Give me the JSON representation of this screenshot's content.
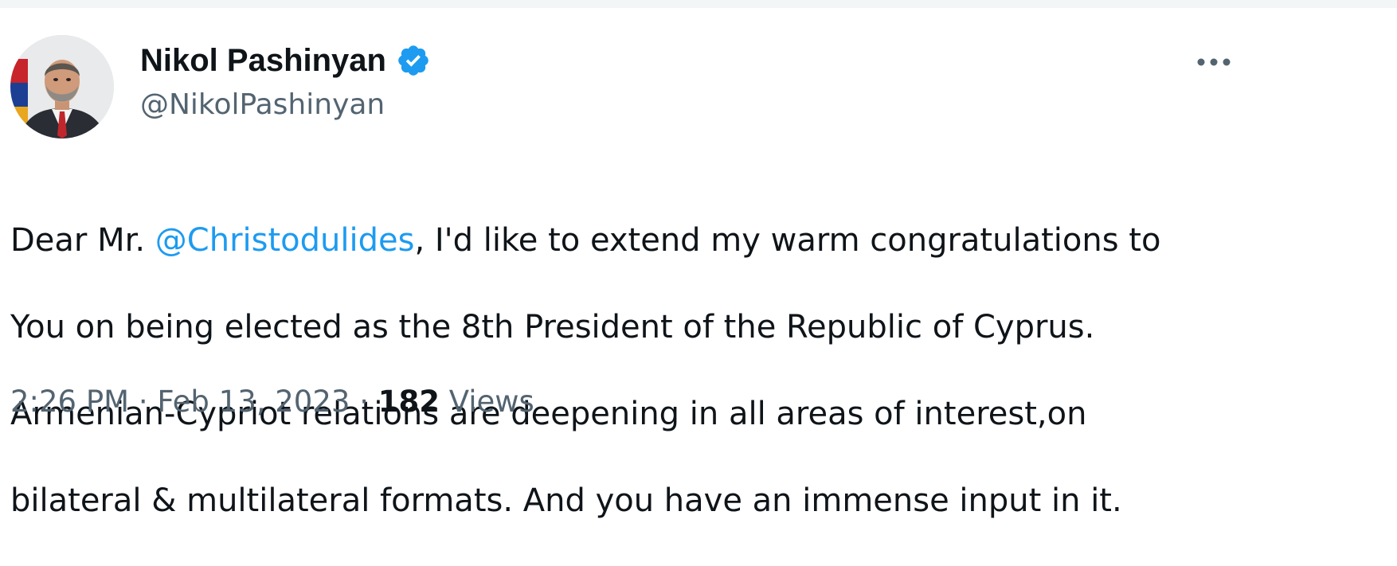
{
  "author": {
    "name": "Nikol Pashinyan",
    "handle": "@NikolPashinyan",
    "verified": true
  },
  "tweet": {
    "line1_before": "Dear Mr. ",
    "mention": "@Christodulides",
    "line1_after": ", I'd like to extend my warm congratulations to",
    "line2": "You on being elected as the 8th President of the Republic of Cyprus.",
    "line3": "Armenian-Cypriot relations are deepening in all areas of interest,on",
    "line4": "bilateral & multilateral formats. And you have an immense input in it."
  },
  "meta": {
    "time": "2:26 PM",
    "separator": " · ",
    "date": "Feb 13, 2023",
    "views_count": "182",
    "views_label": " Views"
  },
  "icons": {
    "avatar": "profile-photo",
    "verified": "verified-badge-icon",
    "more": "more-options-icon"
  },
  "colors": {
    "text": "#0f1419",
    "secondary": "#536471",
    "accent": "#1d9bf0"
  }
}
